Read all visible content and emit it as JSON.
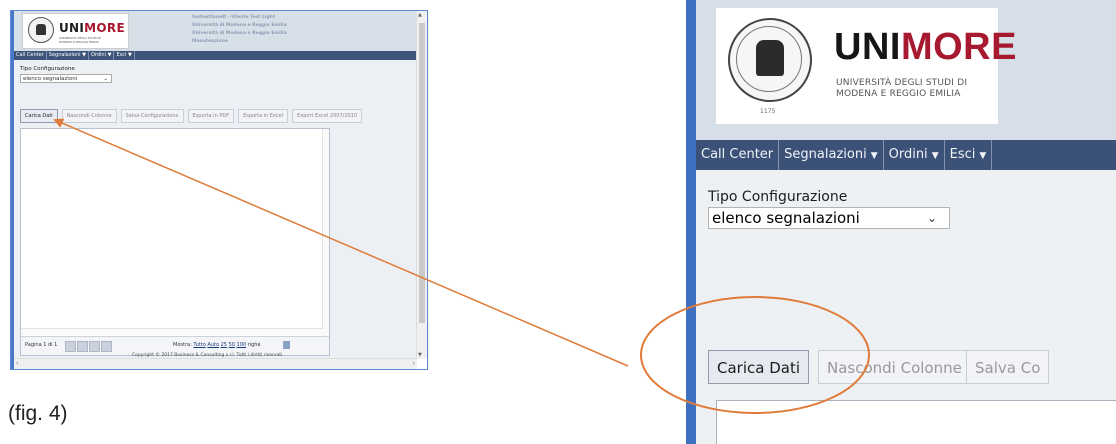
{
  "brand": {
    "name_part1": "UNI",
    "name_part2": "MORE",
    "subtitle_line1": "UNIVERSITÀ DEGLI STUDI DI",
    "subtitle_line2": "MODENA E REGGIO EMILIA",
    "year": "1175"
  },
  "header_info": {
    "line1": "testnettaredt - Utente Test Light",
    "line2": "Università di Modena e Reggio Emilia",
    "line3": "Università di Modena e Reggio Emilia",
    "line4": "Manutenzione"
  },
  "menu": [
    {
      "label": "Call Center",
      "dropdown": false
    },
    {
      "label": "Segnalazioni",
      "dropdown": true
    },
    {
      "label": "Ordini",
      "dropdown": true
    },
    {
      "label": "Esci",
      "dropdown": true
    }
  ],
  "config": {
    "label": "Tipo Configurazione",
    "selected": "elenco segnalazioni"
  },
  "toolbar": {
    "carica": "Carica Dati",
    "nascondi": "Nascondi Colonne",
    "salva": "Salva Configurazione",
    "salva_zoom": "Salva Co",
    "pdf": "Esporta in PDF",
    "excel": "Esporta in Excel",
    "excel2007": "Export Excel 2007/2010"
  },
  "pager": {
    "page_text": "Pagina 1 di 1",
    "mostra": "Mostra:",
    "opt_tutto": "Tutto",
    "opt_auto": "Auto",
    "opt_25": "25",
    "opt_50": "50",
    "opt_100": "100",
    "righe": "righe"
  },
  "footer": {
    "copyright": "Copyright © 2017 Business & Consulting s.r.l. Tutti i diritti riservati"
  },
  "caption": "(fig. 4)",
  "colors": {
    "brand_red": "#a6192e",
    "menu_bar": "#3f5479",
    "annotation": "#e07b39",
    "frame_blue": "#4a78c8"
  },
  "icons": {
    "dropdown": "triangle-down",
    "select_chevron": "chevron-down",
    "scroll_up": "arrow-up",
    "scroll_down": "arrow-down",
    "scroll_left": "arrow-left",
    "scroll_right": "arrow-right"
  }
}
